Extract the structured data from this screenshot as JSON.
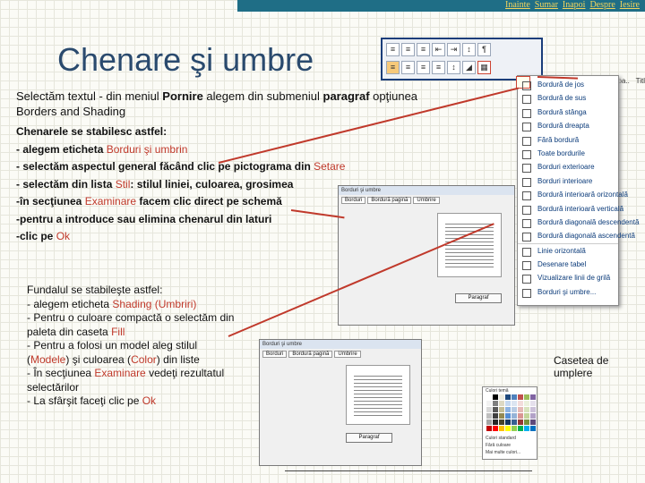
{
  "nav": {
    "inainte": "Inainte",
    "sumar": "Sumar",
    "inapoi": "Inapoi",
    "despre": "Despre",
    "iesire": "Iesire"
  },
  "title": "Chenare şi umbre",
  "intro": {
    "p1": "Selectăm textul -  din meniul ",
    "pornire": "Pornire",
    "p2": " alegem din submeniul ",
    "paragraf": "paragraf",
    "p3": " opţiunea",
    "borders": "Borders and Shading"
  },
  "steps": {
    "s1": "Chenarele se stabilesc astfel:",
    "s2a": "- alegem eticheta ",
    "s2b": "Borduri şi umbrin",
    "s3a": "- selectăm aspectul general făcând clic pe pictograma din ",
    "s3b": "Setare",
    "s4a": "- selectăm din lista ",
    "s4b": "Stil",
    ": ": "",
    "s4c": ": stilul liniei, culoarea, grosimea",
    "s5a": "-în secţiunea ",
    "s5b": "Examinare",
    "s5c": " facem clic direct pe schemă",
    "s6": "-pentru a introduce sau elimina chenarul din laturi",
    "s7a": "-clic pe ",
    "s7b": "Ok"
  },
  "fundal": {
    "l1a": "Fundalul se stabileşte astfel:",
    "l2a": "- alegem eticheta ",
    "l2b": "Shading (Umbriri)",
    "l3": "- Pentru o culoare compactă o selectăm din",
    "l4a": "paleta din caseta ",
    "l4b": "Fill",
    "l5": "- Pentru a folosi un model aleg stilul",
    "l6a": "(",
    "l6b": "Modele",
    "l6c": ") şi culoarea (",
    "l6d": "Color",
    "l6e": ") din liste",
    "l7a": "- În secţiunea ",
    "l7b": "Examinare",
    "l7c": " vedeţi rezultatul",
    "l8": "selectărilor",
    "l9a": "- La sfârşit faceţi clic pe ",
    "l9b": "Ok"
  },
  "caseta": "Casetea de umplere",
  "menu_top": {
    "a": "rmal",
    "b": "I Fără spa..",
    "c": "Titl"
  },
  "menu_items": [
    "Bordură de jos",
    "Bordură de sus",
    "Bordură stânga",
    "Bordură dreapta",
    "Fără bordură",
    "Toate bordurile",
    "Borduri exterioare",
    "Borduri interioare",
    "Bordură interioară orizontală",
    "Bordură interioară verticală",
    "Bordură diagonală descendentă",
    "Bordură diagonală ascendentă",
    "Linie orizontală",
    "Desenare tabel",
    "Vizualizare linii de grilă",
    "Borduri şi umbre..."
  ],
  "dialog1": {
    "title": "Borduri şi umbre",
    "tabs": [
      "Borduri",
      "Bordură pagină",
      "Umbrire"
    ],
    "apply": "Paragraf"
  },
  "dialog2": {
    "title": "Borduri şi umbre",
    "tabs": [
      "Borduri",
      "Bordură pagină",
      "Umbrire"
    ],
    "apply": "Paragraf"
  },
  "palette": {
    "title": "Culori temă",
    "std": "Culori standard",
    "none": "Fără culoare",
    "more": "Mai multe culori..."
  },
  "colors": {
    "accent": "#c0392b",
    "title": "#2a4a6e",
    "topbar": "#1f6e86",
    "nav": "#f2d45c"
  }
}
